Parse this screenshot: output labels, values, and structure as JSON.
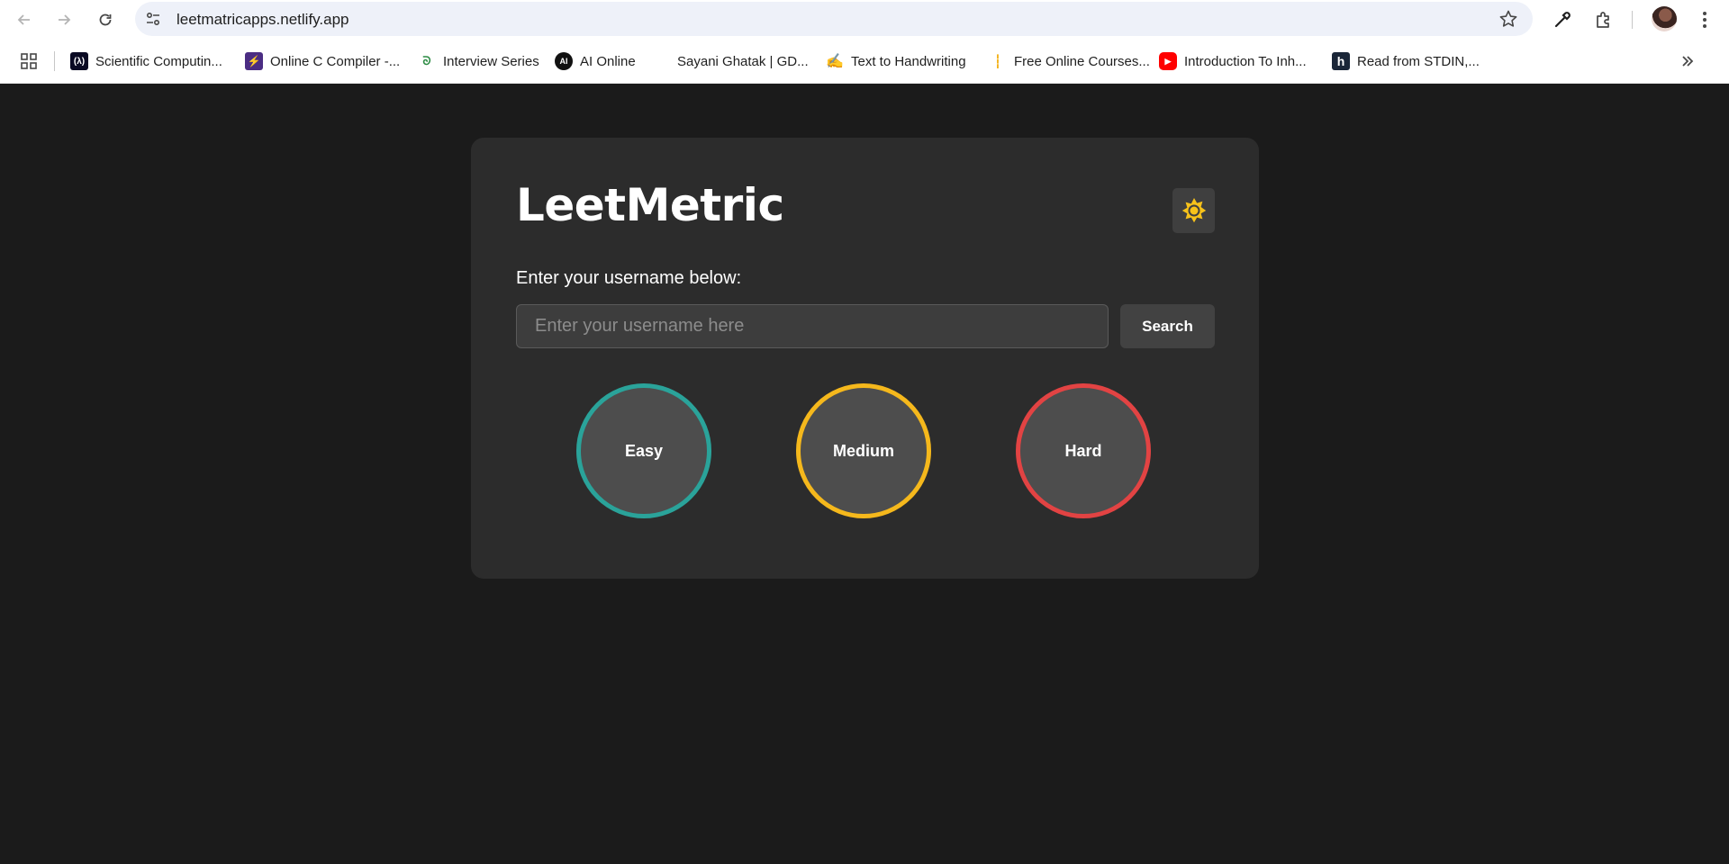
{
  "browser": {
    "url": "leetmatricapps.netlify.app",
    "bookmarks": [
      {
        "label": "Scientific Computin...",
        "icon": "freecodecamp-icon"
      },
      {
        "label": "Online C Compiler -...",
        "icon": "compiler-icon"
      },
      {
        "label": "Interview Series",
        "icon": "geeksforgeeks-icon"
      },
      {
        "label": "AI Online",
        "icon": "ai-icon"
      },
      {
        "label": "Sayani Ghatak | GD...",
        "icon": ""
      },
      {
        "label": "Text to Handwriting",
        "icon": "pen-icon"
      },
      {
        "label": "Free Online Courses...",
        "icon": "courses-icon"
      },
      {
        "label": "Introduction To Inh...",
        "icon": "youtube-icon"
      },
      {
        "label": "Read from STDIN,...",
        "icon": "hackerrank-icon"
      }
    ]
  },
  "app": {
    "title": "LeetMetric",
    "theme_toggle_icon": "sun-icon",
    "prompt": "Enter your username below:",
    "input_placeholder": "Enter your username here",
    "search_label": "Search",
    "difficulty": [
      {
        "label": "Easy",
        "color": "#2aa39a"
      },
      {
        "label": "Medium",
        "color": "#f5b81c"
      },
      {
        "label": "Hard",
        "color": "#e24343"
      }
    ]
  },
  "colors": {
    "page_bg": "#1b1b1b",
    "card_bg": "#2c2c2c",
    "sun": "#f7c21a"
  }
}
